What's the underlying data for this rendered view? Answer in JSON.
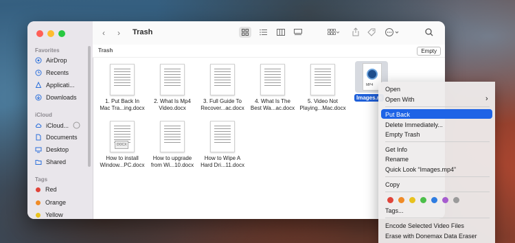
{
  "window": {
    "title": "Trash",
    "path_label": "Trash",
    "empty_button": "Empty"
  },
  "sidebar": {
    "favorites_header": "Favorites",
    "favorites": [
      {
        "label": "AirDrop",
        "icon": "airdrop-icon"
      },
      {
        "label": "Recents",
        "icon": "clock-icon"
      },
      {
        "label": "Applicati...",
        "icon": "applications-icon"
      },
      {
        "label": "Downloads",
        "icon": "download-icon"
      }
    ],
    "icloud_header": "iCloud",
    "icloud": [
      {
        "label": "iCloud...",
        "icon": "cloud-icon"
      },
      {
        "label": "Documents",
        "icon": "document-icon"
      },
      {
        "label": "Desktop",
        "icon": "desktop-icon"
      },
      {
        "label": "Shared",
        "icon": "shared-folder-icon"
      }
    ],
    "tags_header": "Tags",
    "tags": [
      {
        "label": "Red",
        "color": "#e0443a"
      },
      {
        "label": "Orange",
        "color": "#f08b27"
      },
      {
        "label": "Yellow",
        "color": "#e8c21e"
      }
    ]
  },
  "files": [
    {
      "line1": "1. Put Back In",
      "line2": "Mac Tra...ing.docx"
    },
    {
      "line1": "2. What Is Mp4",
      "line2": "Video.docx"
    },
    {
      "line1": "3. Full Guide To",
      "line2": "Recover...ac.docx"
    },
    {
      "line1": "4. What Is The",
      "line2": "Best Wa...ac.docx"
    },
    {
      "line1": "5. Video Not",
      "line2": "Playing...Mac.docx"
    },
    {
      "line1": "How to install",
      "line2": "Window...PC.docx"
    },
    {
      "line1": "How to upgrade",
      "line2": "from Wi...10.docx"
    },
    {
      "line1": "How to Wipe A",
      "line2": "Hard Dri...11.docx"
    }
  ],
  "selected_file": {
    "name": "Images.m",
    "badge": "MP4"
  },
  "context_menu": {
    "open": "Open",
    "open_with": "Open With",
    "put_back": "Put Back",
    "delete_immediately": "Delete Immediately...",
    "empty_trash": "Empty Trash",
    "get_info": "Get Info",
    "rename": "Rename",
    "quick_look": "Quick Look “Images.mp4”",
    "copy": "Copy",
    "tags": "Tags...",
    "encode": "Encode Selected Video Files",
    "erase": "Erase with Donemax Data Eraser",
    "tag_colors": [
      "#e0443a",
      "#f08b27",
      "#e8c21e",
      "#4cbf4a",
      "#2f7de1",
      "#a65ccf",
      "#9a9a9a"
    ]
  }
}
